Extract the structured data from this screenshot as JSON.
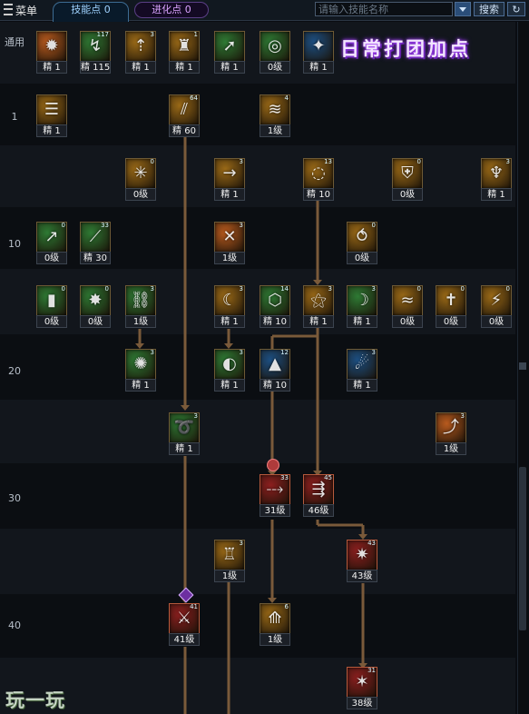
{
  "topbar": {
    "menu_label": "菜单",
    "skill_points_label": "技能点 0",
    "evolution_points_label": "进化点 0",
    "search_placeholder": "请输入技能名称",
    "search_button": "搜索"
  },
  "row_labels": [
    "通用",
    "1",
    "10",
    "20",
    "30",
    "40"
  ],
  "annotation": "日常打团加点",
  "watermark": "玩一玩",
  "skills": [
    {
      "name": "skill-burst",
      "level": "精 1",
      "count": "",
      "theme": "orange",
      "glyph": "✹"
    },
    {
      "name": "skill-swift",
      "level": "精 115",
      "count": "117",
      "theme": "green",
      "glyph": "↯"
    },
    {
      "name": "skill-rise",
      "level": "精 1",
      "count": "3",
      "theme": "gold",
      "glyph": "⇡"
    },
    {
      "name": "skill-stand",
      "level": "精 1",
      "count": "1",
      "theme": "gold",
      "glyph": "♜"
    },
    {
      "name": "skill-dash",
      "level": "精 1",
      "count": "",
      "theme": "green",
      "glyph": "➚"
    },
    {
      "name": "skill-target",
      "level": "0级",
      "count": "",
      "theme": "green",
      "glyph": "◎"
    },
    {
      "name": "skill-wings",
      "level": "精 1",
      "count": "",
      "theme": "blue",
      "glyph": "✦"
    },
    {
      "name": "skill-book",
      "level": "精 1",
      "count": "",
      "theme": "gold",
      "glyph": "☰"
    },
    {
      "name": "skill-slash-a",
      "level": "精 60",
      "count": "64",
      "theme": "gold",
      "glyph": "⫽"
    },
    {
      "name": "skill-wave-a",
      "level": "1级",
      "count": "4",
      "theme": "gold",
      "glyph": "≋"
    },
    {
      "name": "skill-spark-a",
      "level": "0级",
      "count": "0",
      "theme": "gold",
      "glyph": "✳"
    },
    {
      "name": "skill-arrow-a",
      "level": "精 1",
      "count": "3",
      "theme": "gold",
      "glyph": "→"
    },
    {
      "name": "skill-vortex",
      "level": "精 10",
      "count": "13",
      "theme": "gold",
      "glyph": "◌"
    },
    {
      "name": "skill-shield",
      "level": "0级",
      "count": "0",
      "theme": "gold",
      "glyph": "⛨"
    },
    {
      "name": "skill-fan",
      "level": "精 1",
      "count": "3",
      "theme": "gold",
      "glyph": "♆"
    },
    {
      "name": "skill-needle-a",
      "level": "0级",
      "count": "0",
      "theme": "green",
      "glyph": "↗"
    },
    {
      "name": "skill-needle-b",
      "level": "精 30",
      "count": "33",
      "theme": "green",
      "glyph": "⟋"
    },
    {
      "name": "skill-x-strike",
      "level": "1级",
      "count": "3",
      "theme": "orange",
      "glyph": "✕"
    },
    {
      "name": "skill-spiral",
      "level": "0级",
      "count": "0",
      "theme": "gold",
      "glyph": "⥀"
    },
    {
      "name": "skill-bar",
      "level": "0级",
      "count": "0",
      "theme": "green",
      "glyph": "▮"
    },
    {
      "name": "skill-star",
      "level": "0级",
      "count": "0",
      "theme": "green",
      "glyph": "✸"
    },
    {
      "name": "skill-chain",
      "level": "1级",
      "count": "3",
      "theme": "green",
      "glyph": "⛓"
    },
    {
      "name": "skill-moon-d",
      "level": "精 1",
      "count": "3",
      "theme": "gold",
      "glyph": "☾"
    },
    {
      "name": "skill-guard",
      "level": "精 10",
      "count": "14",
      "theme": "green",
      "glyph": "⬡"
    },
    {
      "name": "skill-rune",
      "level": "精 1",
      "count": "3",
      "theme": "gold",
      "glyph": "⚝"
    },
    {
      "name": "skill-crescent",
      "level": "精 1",
      "count": "3",
      "theme": "green",
      "glyph": "☽"
    },
    {
      "name": "skill-wind",
      "level": "0级",
      "count": "0",
      "theme": "gold",
      "glyph": "≈"
    },
    {
      "name": "skill-cross",
      "level": "0级",
      "count": "0",
      "theme": "gold",
      "glyph": "✝"
    },
    {
      "name": "skill-claw",
      "level": "0级",
      "count": "0",
      "theme": "gold",
      "glyph": "⚡"
    },
    {
      "name": "skill-burst-green",
      "level": "精 1",
      "count": "3",
      "theme": "green",
      "glyph": "✺"
    },
    {
      "name": "skill-halfmoon",
      "level": "精 1",
      "count": "3",
      "theme": "green",
      "glyph": "◐"
    },
    {
      "name": "skill-pyramid",
      "level": "精 10",
      "count": "12",
      "theme": "blue",
      "glyph": "▲"
    },
    {
      "name": "skill-wolf",
      "level": "精 1",
      "count": "3",
      "theme": "blue",
      "glyph": "☄"
    },
    {
      "name": "skill-cyclone",
      "level": "精 1",
      "count": "3",
      "theme": "green",
      "glyph": "➰"
    },
    {
      "name": "skill-swing",
      "level": "1级",
      "count": "3",
      "theme": "orange",
      "glyph": "⤴"
    },
    {
      "name": "skill-slash-q",
      "level": "31级",
      "count": "33",
      "theme": "red",
      "glyph": "⤏"
    },
    {
      "name": "skill-rush-w",
      "level": "46级",
      "count": "45",
      "theme": "red",
      "glyph": "⇶"
    },
    {
      "name": "skill-tower",
      "level": "1级",
      "count": "3",
      "theme": "gold",
      "glyph": "♖"
    },
    {
      "name": "skill-gale",
      "level": "43级",
      "count": "43",
      "theme": "red",
      "glyph": "✷"
    },
    {
      "name": "skill-blade-a",
      "level": "41级",
      "count": "41",
      "theme": "red",
      "glyph": "⚔"
    },
    {
      "name": "skill-thrust",
      "level": "1级",
      "count": "6",
      "theme": "gold",
      "glyph": "⟰"
    },
    {
      "name": "skill-storm",
      "level": "38级",
      "count": "31",
      "theme": "red",
      "glyph": "✶"
    }
  ],
  "theme_colors": {
    "orange": "#b85a1e",
    "green": "#2e7a34",
    "gold": "#9b6a17",
    "blue": "#1c4f82",
    "red": "#8c1f1f"
  }
}
